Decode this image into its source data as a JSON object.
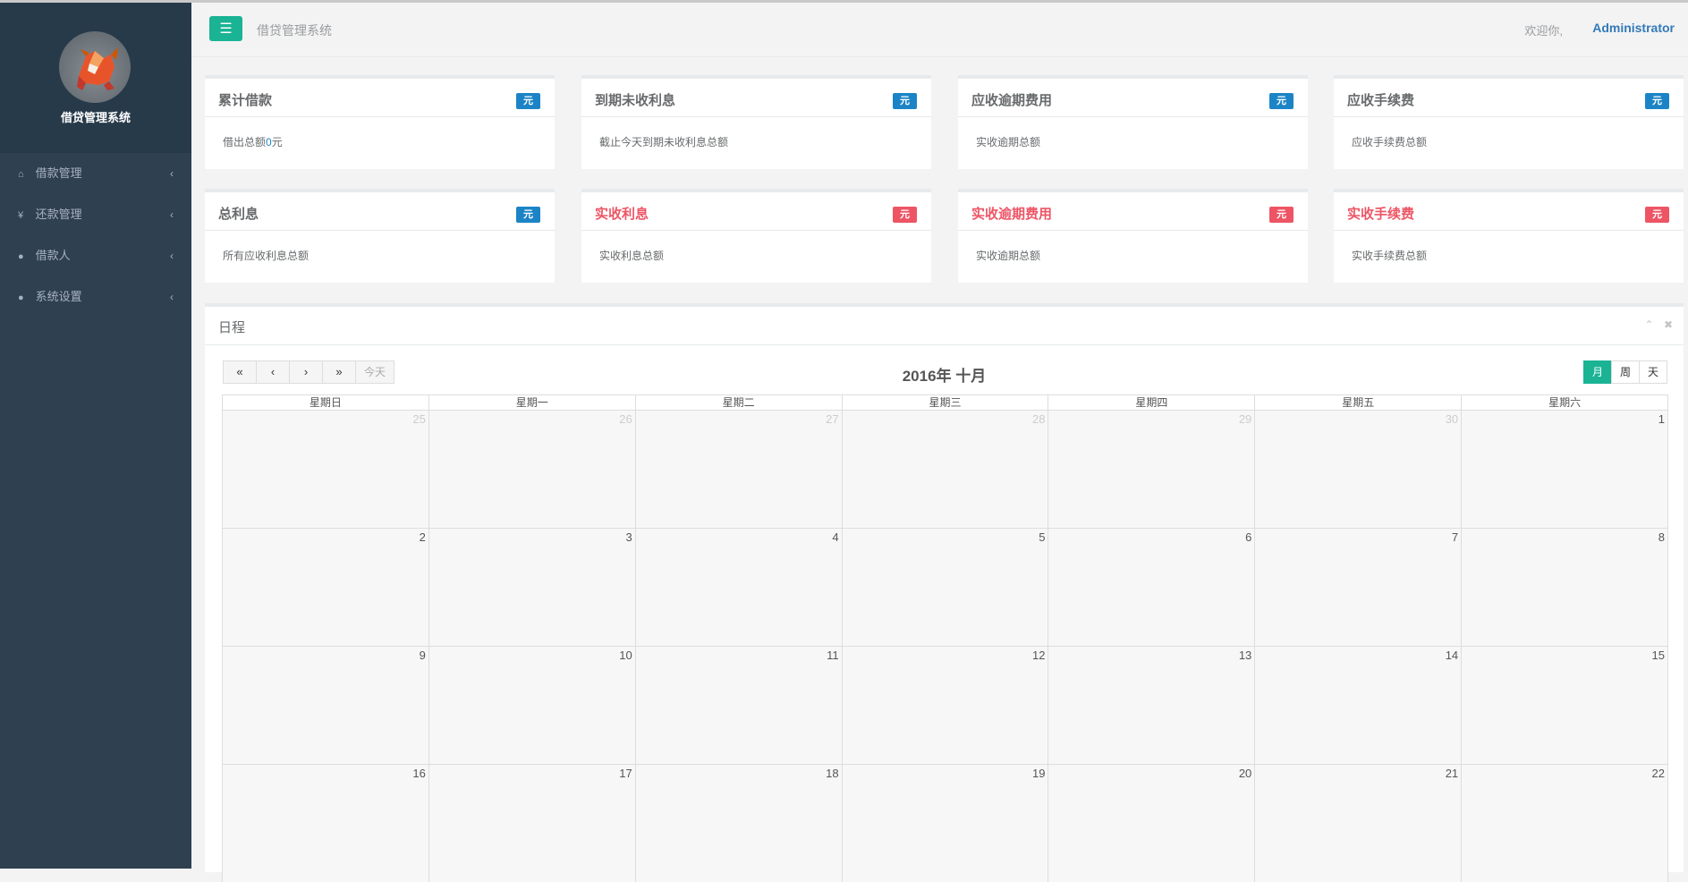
{
  "app": {
    "system_name": "借贷管理系统",
    "top_title": "借贷管理系统",
    "welcome": "欢迎你,",
    "user": "Administrator"
  },
  "sidebar": {
    "items": [
      {
        "label": "借款管理",
        "icon": "home-icon"
      },
      {
        "label": "还款管理",
        "icon": "yen-icon"
      },
      {
        "label": "借款人",
        "icon": "user-icon"
      },
      {
        "label": "系统设置",
        "icon": "user-icon"
      }
    ]
  },
  "cards": [
    {
      "title": "累计借款",
      "badge": "元",
      "body_prefix": "借出总额",
      "body_num": "0",
      "body_suffix": "元"
    },
    {
      "title": "到期未收利息",
      "badge": "元",
      "body": "截止今天到期未收利息总额"
    },
    {
      "title": "应收逾期费用",
      "badge": "元",
      "body": "实收逾期总额"
    },
    {
      "title": "应收手续费",
      "badge": "元",
      "body": "应收手续费总额"
    },
    {
      "title": "总利息",
      "badge": "元",
      "body": "所有应收利息总额"
    },
    {
      "title": "实收利息",
      "badge": "元",
      "body": "实收利息总额"
    },
    {
      "title": "实收逾期费用",
      "badge": "元",
      "body": "实收逾期总额"
    },
    {
      "title": "实收手续费",
      "badge": "元",
      "body": "实收手续费总额"
    }
  ],
  "colors": {
    "sidebar_bg": "#2f4050",
    "accent_green": "#1ab394",
    "badge_blue": "#1c84c6",
    "badge_red": "#ed5565"
  },
  "schedule": {
    "title": "日程",
    "calendar_title": "2016年 十月",
    "nav": {
      "prev_year": "«",
      "prev": "‹",
      "next": "›",
      "next_year": "»",
      "today": "今天"
    },
    "views": {
      "month": "月",
      "week": "周",
      "day": "天",
      "active": "month"
    },
    "weekdays": [
      "星期日",
      "星期一",
      "星期二",
      "星期三",
      "星期四",
      "星期五",
      "星期六"
    ],
    "weeks": [
      [
        "25",
        "26",
        "27",
        "28",
        "29",
        "30",
        "1"
      ],
      [
        "2",
        "3",
        "4",
        "5",
        "6",
        "7",
        "8"
      ],
      [
        "9",
        "10",
        "11",
        "12",
        "13",
        "14",
        "15"
      ],
      [
        "16",
        "17",
        "18",
        "19",
        "20",
        "21",
        "22"
      ]
    ],
    "other_month_days": [
      "25",
      "26",
      "27",
      "28",
      "29",
      "30"
    ]
  }
}
